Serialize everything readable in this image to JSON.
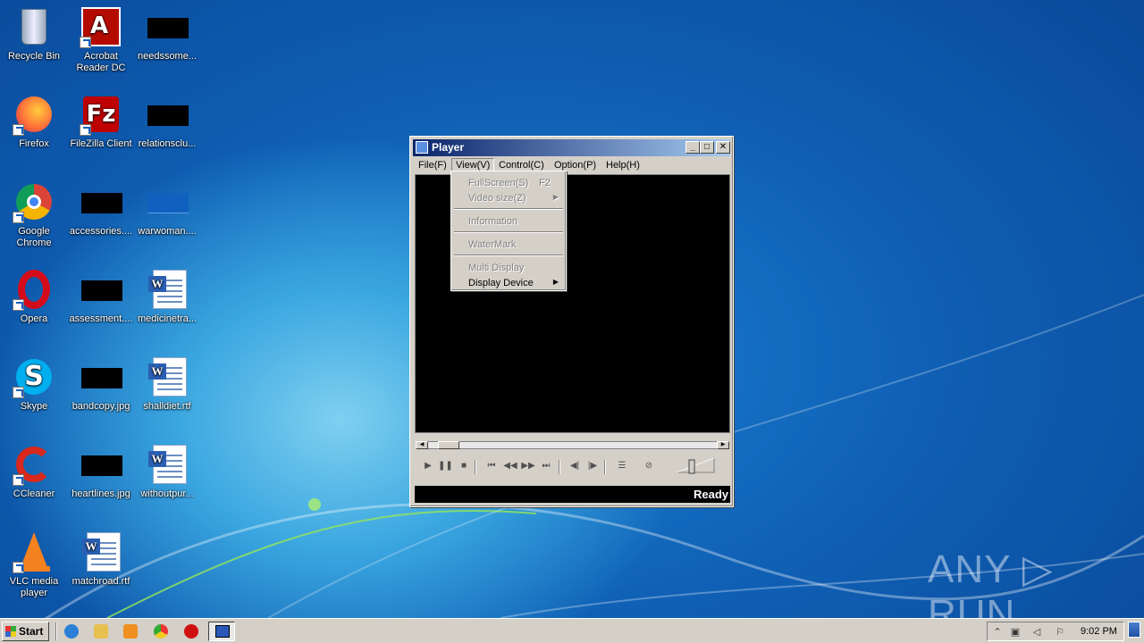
{
  "desktop": {
    "icons": [
      {
        "label": "Recycle Bin",
        "type": "recycle"
      },
      {
        "label": "Acrobat\nReader DC",
        "type": "acrobat"
      },
      {
        "label": "needssome...",
        "type": "black"
      },
      {
        "label": "Firefox",
        "type": "firefox"
      },
      {
        "label": "FileZilla Client",
        "type": "filezilla"
      },
      {
        "label": "relationsclu...",
        "type": "black"
      },
      {
        "label": "Google\nChrome",
        "type": "chrome"
      },
      {
        "label": "accessories....",
        "type": "black"
      },
      {
        "label": "warwoman....",
        "type": "blue"
      },
      {
        "label": "Opera",
        "type": "opera"
      },
      {
        "label": "assessment....",
        "type": "black"
      },
      {
        "label": "medicinetra...",
        "type": "word"
      },
      {
        "label": "Skype",
        "type": "skype"
      },
      {
        "label": "bandcopy.jpg",
        "type": "black"
      },
      {
        "label": "shalldiet.rtf",
        "type": "word"
      },
      {
        "label": "CCleaner",
        "type": "ccleaner"
      },
      {
        "label": "heartlines.jpg",
        "type": "black"
      },
      {
        "label": "withoutpur...",
        "type": "word"
      },
      {
        "label": "VLC media\nplayer",
        "type": "vlc"
      },
      {
        "label": "matchroad.rtf",
        "type": "word"
      }
    ]
  },
  "player": {
    "title": "Player",
    "minimize": "_",
    "maximize": "□",
    "close": "✕",
    "menu": [
      "File(F)",
      "View(V)",
      "Control(C)",
      "Option(P)",
      "Help(H)"
    ],
    "active_menu": "View(V)",
    "view_menu": [
      {
        "label": "FullScreen(S)",
        "shortcut": "F2",
        "enabled": false,
        "submenu": false
      },
      {
        "label": "Video size(Z)",
        "shortcut": "",
        "enabled": false,
        "submenu": true
      },
      {
        "label": "Information",
        "shortcut": "",
        "enabled": false,
        "submenu": false
      },
      {
        "label": "WaterMark",
        "shortcut": "",
        "enabled": false,
        "submenu": false
      },
      {
        "label": "Multi Display",
        "shortcut": "",
        "enabled": false,
        "submenu": false
      },
      {
        "label": "Display Device",
        "shortcut": "",
        "enabled": true,
        "submenu": true
      }
    ],
    "status": "Ready",
    "seek_left": "◀",
    "seek_right": "▶",
    "controls": [
      {
        "name": "play-icon",
        "glyph": "▶"
      },
      {
        "name": "pause-icon",
        "glyph": "❚❚"
      },
      {
        "name": "stop-icon",
        "glyph": "■"
      },
      {
        "name": "skip-start-icon",
        "glyph": "⏮"
      },
      {
        "name": "rewind-icon",
        "glyph": "◀◀"
      },
      {
        "name": "fast-forward-icon",
        "glyph": "▶▶"
      },
      {
        "name": "skip-end-icon",
        "glyph": "⏭"
      },
      {
        "name": "frame-back-icon",
        "glyph": "◀|"
      },
      {
        "name": "frame-forward-icon",
        "glyph": "|▶"
      },
      {
        "name": "playlist-icon",
        "glyph": "☰"
      },
      {
        "name": "mute-icon",
        "glyph": "⊘"
      }
    ]
  },
  "watermark": "ANY ▷ RUN",
  "taskbar": {
    "start_label": "Start",
    "clock": "9:02 PM",
    "tray_icons": [
      "chevron-up-icon",
      "network-icon",
      "volume-icon",
      "flag-icon"
    ]
  },
  "colors": {
    "titlebar_start": "#0a246a",
    "titlebar_end": "#a6caf0",
    "window_face": "#d4d0c8"
  }
}
